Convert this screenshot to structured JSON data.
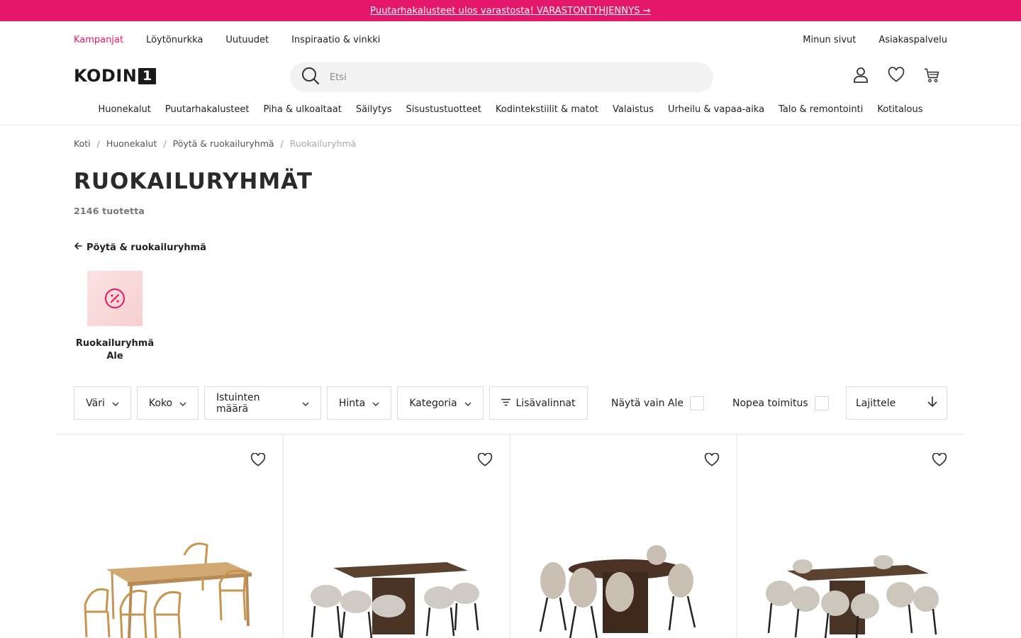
{
  "promo": {
    "text": "Puutarhakalusteet ulos varastosta! VARASTONTYHJENNYS →"
  },
  "utility": {
    "left": [
      "Kampanjat",
      "Löytönurkka",
      "Uutuudet",
      "Inspiraatio & vinkki"
    ],
    "right": [
      "Minun sivut",
      "Asiakaspalvelu"
    ]
  },
  "logo": {
    "text": "KODIN",
    "number": "1"
  },
  "search": {
    "placeholder": "Etsi"
  },
  "header_icons": [
    "user-icon",
    "heart-icon",
    "cart-icon"
  ],
  "categories": [
    "Huonekalut",
    "Puutarhakalusteet",
    "Piha & ulkoaltaat",
    "Säilytys",
    "Sisustustuotteet",
    "Kodintekstiilit & matot",
    "Valaistus",
    "Urheilu & vapaa-aika",
    "Talo & remontointi",
    "Kotitalous"
  ],
  "breadcrumb": {
    "items": [
      "Koti",
      "Huonekalut",
      "Pöytä & ruokailuryhmä"
    ],
    "current": "Ruokailuryhmä"
  },
  "page": {
    "title": "RUOKAILURYHMÄT",
    "count": "2146 tuotetta",
    "back_label": "Pöytä & ruokailuryhmä"
  },
  "subcategory": {
    "line1": "Ruokailuryhmä",
    "line2": "Ale"
  },
  "filters": {
    "buttons": [
      "Väri",
      "Koko",
      "Istuinten määrä",
      "Hinta",
      "Kategoria"
    ],
    "more": "Lisävalinnat",
    "sale_toggle": "Näytä vain Ale",
    "fast_toggle": "Nopea toimitus",
    "sort": "Lajittele"
  },
  "colors": {
    "accent": "#e5176a"
  }
}
